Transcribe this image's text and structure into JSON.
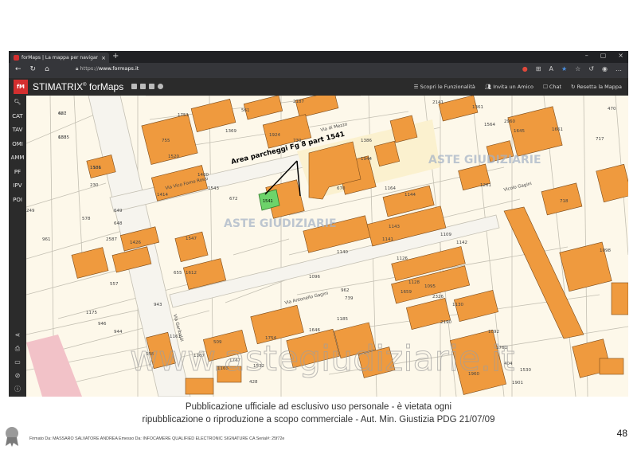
{
  "browser": {
    "tab_title": "forMaps | La mappa per navigare",
    "tab_close": "×",
    "new_tab": "+",
    "window_buttons": [
      "–",
      "▢",
      "×"
    ],
    "nav_glyphs": [
      "←",
      "↻",
      "⌂"
    ],
    "url_prefix": "https://",
    "url_host": "www.formaps.it"
  },
  "app": {
    "logo_text": "fM",
    "brand_name": "STIMATRIX",
    "brand_mark": "®",
    "brand_suffix": " forMaps",
    "menu": [
      {
        "label": "Scopri le Funzionalità",
        "icon": "list-icon"
      },
      {
        "label": "Invita un Amico",
        "icon": "users-icon"
      },
      {
        "label": "Chat",
        "icon": "chat-icon"
      },
      {
        "label": "Resetta la Mappa",
        "icon": "refresh-icon"
      }
    ]
  },
  "sidebar": {
    "items": [
      "CAT",
      "TAV",
      "OMI",
      "AMM",
      "PF",
      "IPV",
      "POI"
    ],
    "bottom_icons": [
      "share-icon",
      "print-icon",
      "folder-icon",
      "eye-off-icon",
      "info-icon"
    ]
  },
  "map": {
    "colors": {
      "building": "#ef9a3e",
      "building_stroke": "#7a4a1a",
      "parcel_line": "#c3bfb2",
      "highlight": "#6dd36a",
      "paved": "#fbf1cf",
      "road": "#f3f1ea"
    },
    "annotation": "Area parcheggi Fg 8 part 1541",
    "parcel_label": "1541",
    "streets": [
      "Via Garibaldi",
      "Via Vico Forno Rossi",
      "Via Antonello Gagini",
      "Via di Mezzo",
      "Vicolo Gagini"
    ],
    "parcels": [
      "681",
      "683",
      "1101",
      "230",
      "249",
      "961",
      "578",
      "649",
      "648",
      "2587",
      "1426",
      "1547",
      "1612",
      "655",
      "557",
      "1175",
      "946",
      "944",
      "943",
      "558",
      "1161",
      "1167",
      "509",
      "1165",
      "1747",
      "1754",
      "1751",
      "1369",
      "2187",
      "561",
      "1924",
      "755",
      "1520",
      "1414",
      "739",
      "1400",
      "1543",
      "672",
      "670",
      "1386",
      "1944",
      "1164",
      "1144",
      "1143",
      "1141",
      "1140",
      "1109",
      "1142",
      "1126",
      "1128",
      "1659",
      "1095",
      "2326",
      "1130",
      "2190",
      "1185",
      "2141",
      "1361",
      "1564",
      "2960",
      "1645",
      "1661",
      "470",
      "717",
      "718",
      "1098",
      "1261",
      "1092",
      "1761",
      "404",
      "1901",
      "1960",
      "1530",
      "1532",
      "1096",
      "962",
      "739",
      "1646",
      "428",
      "427",
      "1385",
      "1586"
    ],
    "watermark_logo": "ASTE GIUDIZIARIE",
    "watermark_url": "www.astegiudiziarie.it"
  },
  "footer": {
    "caption_line1": "Pubblicazione ufficiale ad esclusivo uso personale - è vietata ogni",
    "caption_line2": "ripubblicazione o riproduzione a scopo commerciale - Aut. Min. Giustizia PDG 21/07/09",
    "page_number": "48",
    "signature": "Firmato Da: MASSARO SALVATORE ANDREA Emesso Da: INFOCAMERE QUALIFIED ELECTRONIC SIGNATURE CA Serial#: 25f72e"
  }
}
